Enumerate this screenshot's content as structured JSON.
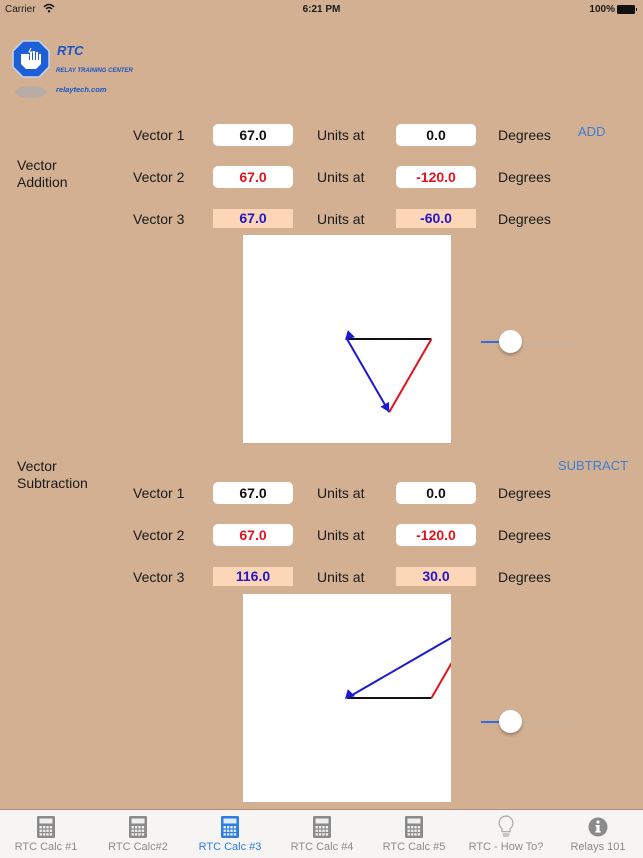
{
  "status_bar": {
    "carrier": "Carrier",
    "time": "6:21 PM",
    "battery": "100%"
  },
  "logo": {
    "title": "RTC",
    "full_name": "RELAY TRAINING CENTER",
    "url": "relaytech.com"
  },
  "addition": {
    "section_label": "Vector\nAddition",
    "section_label_line1": "Vector",
    "section_label_line2": "Addition",
    "action_label": "ADD",
    "rows": [
      {
        "label": "Vector 1",
        "magnitude": "67.0",
        "units_label": "Units at",
        "angle": "0.0",
        "degrees_label": "Degrees"
      },
      {
        "label": "Vector 2",
        "magnitude": "67.0",
        "units_label": "Units at",
        "angle": "-120.0",
        "degrees_label": "Degrees"
      },
      {
        "label": "Vector 3",
        "magnitude": "67.0",
        "units_label": "Units at",
        "angle": "-60.0",
        "degrees_label": "Degrees"
      }
    ],
    "diagram": {
      "v1": {
        "mag": 67.0,
        "deg": 0.0,
        "color": "#111111"
      },
      "v2": {
        "mag": 67.0,
        "deg": -120.0,
        "color": "#e0141e"
      },
      "v3": {
        "mag": 67.0,
        "deg": -60.0,
        "color": "#1a1ad0"
      },
      "mode": "add"
    },
    "zoom_slider_value": 0.25
  },
  "subtraction": {
    "section_label_line1": "Vector",
    "section_label_line2": "Subtraction",
    "action_label": "SUBTRACT",
    "rows": [
      {
        "label": "Vector 1",
        "magnitude": "67.0",
        "units_label": "Units at",
        "angle": "0.0",
        "degrees_label": "Degrees"
      },
      {
        "label": "Vector 2",
        "magnitude": "67.0",
        "units_label": "Units at",
        "angle": "-120.0",
        "degrees_label": "Degrees"
      },
      {
        "label": "Vector 3",
        "magnitude": "116.0",
        "units_label": "Units at",
        "angle": "30.0",
        "degrees_label": "Degrees"
      }
    ],
    "diagram": {
      "v1": {
        "mag": 67.0,
        "deg": 0.0,
        "color": "#111111"
      },
      "v2": {
        "mag": 67.0,
        "deg": -120.0,
        "color": "#e0141e"
      },
      "v3": {
        "mag": 116.0,
        "deg": 30.0,
        "color": "#1a1ad0"
      },
      "mode": "subtract"
    },
    "zoom_slider_value": 0.25
  },
  "colors": {
    "background": "#d4b092",
    "accent": "#2f7de0",
    "result_field": "#fcd6b6"
  },
  "tabbar": {
    "active_index": 2,
    "items": [
      {
        "label": "RTC Calc #1",
        "icon": "calculator-icon"
      },
      {
        "label": "RTC Calc#2",
        "icon": "calculator-icon"
      },
      {
        "label": "RTC Calc #3",
        "icon": "calculator-icon"
      },
      {
        "label": "RTC Calc #4",
        "icon": "calculator-icon"
      },
      {
        "label": "RTC Calc #5",
        "icon": "calculator-icon"
      },
      {
        "label": "RTC - How To?",
        "icon": "lightbulb-icon"
      },
      {
        "label": "Relays 101",
        "icon": "info-icon"
      }
    ]
  }
}
